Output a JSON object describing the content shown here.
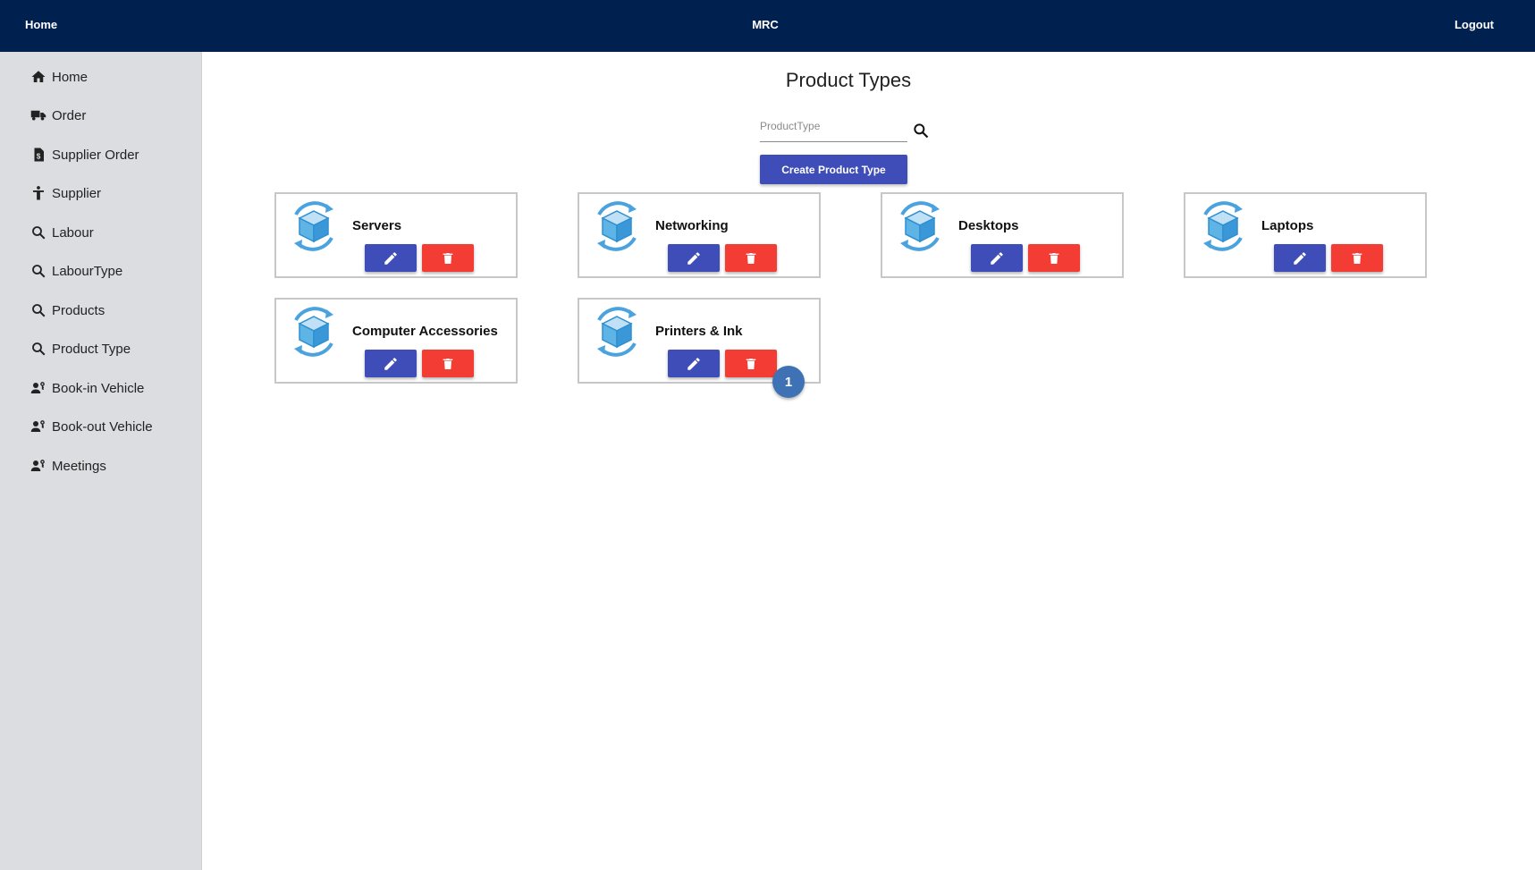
{
  "topbar": {
    "home": "Home",
    "brand": "MRC",
    "logout": "Logout",
    "color": "#002050"
  },
  "sidebar": {
    "items": [
      {
        "label": "Home",
        "icon": "home-icon"
      },
      {
        "label": "Order",
        "icon": "truck-icon"
      },
      {
        "label": "Supplier Order",
        "icon": "invoice-icon"
      },
      {
        "label": "Supplier",
        "icon": "person-icon"
      },
      {
        "label": "Labour",
        "icon": "search-icon"
      },
      {
        "label": "LabourType",
        "icon": "search-icon"
      },
      {
        "label": "Products",
        "icon": "search-icon"
      },
      {
        "label": "Product Type",
        "icon": "search-icon"
      },
      {
        "label": "Book-in Vehicle",
        "icon": "user-key-icon"
      },
      {
        "label": "Book-out Vehicle",
        "icon": "user-key-icon"
      },
      {
        "label": "Meetings",
        "icon": "user-key-icon"
      }
    ]
  },
  "main": {
    "title": "Product Types",
    "search": {
      "placeholder": "ProductType",
      "value": ""
    },
    "create_label": "Create Product Type",
    "cards": [
      {
        "name": "Servers"
      },
      {
        "name": "Networking"
      },
      {
        "name": "Desktops"
      },
      {
        "name": "Laptops"
      },
      {
        "name": "Computer Accessories"
      },
      {
        "name": "Printers & Ink"
      }
    ],
    "badge": "1"
  },
  "colors": {
    "primary": "#3f4db8",
    "danger": "#f33c33",
    "logo": "#4aa3df",
    "sidebar_bg": "#dcdde1"
  }
}
